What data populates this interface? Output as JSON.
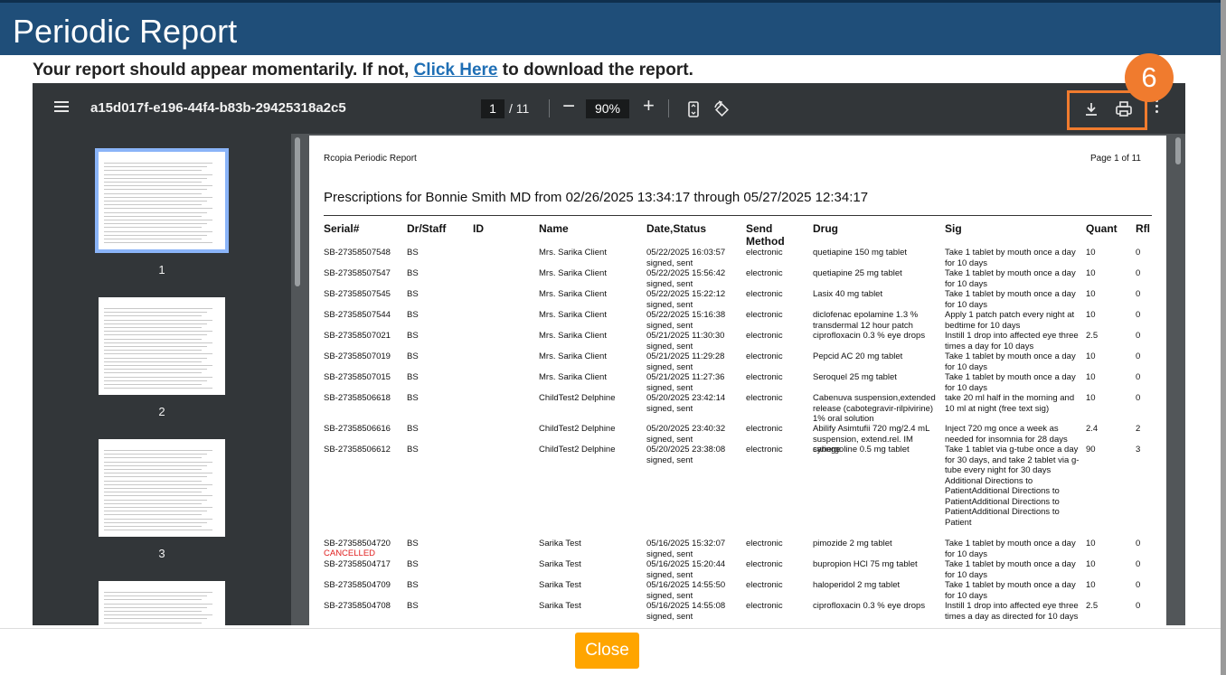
{
  "modal": {
    "title": "Periodic Report"
  },
  "notice": {
    "before": "Your report should appear momentarily. If not, ",
    "link": "Click Here",
    "after": " to download the report."
  },
  "viewer": {
    "file_name": "a15d017f-e196-44f4-b83b-29425318a2c5",
    "page_current": "1",
    "page_total": "/ 11",
    "zoom": "90%",
    "step_badge": "6",
    "thumbnails": [
      "1",
      "2",
      "3"
    ]
  },
  "report": {
    "header_left": "Rcopia Periodic Report",
    "header_right": "Page 1 of 11",
    "title": "Prescriptions for Bonnie Smith MD from 02/26/2025 13:34:17 through 05/27/2025 12:34:17",
    "columns": [
      "Serial#",
      "Dr/Staff",
      "ID",
      "Name",
      "Date,Status",
      "Send Method",
      "Drug",
      "Sig",
      "Quant",
      "Rfl"
    ],
    "rows": [
      [
        "SB-27358507548",
        "BS",
        "",
        "Mrs. Sarika Client",
        "05/22/2025 16:03:57 signed, sent",
        "electronic",
        "quetiapine 150 mg tablet",
        "Take 1 tablet by mouth once a day for 10 days",
        "10",
        "0"
      ],
      [
        "SB-27358507547",
        "BS",
        "",
        "Mrs. Sarika Client",
        "05/22/2025 15:56:42 signed, sent",
        "electronic",
        "quetiapine 25 mg tablet",
        "Take 1 tablet by mouth once a day for 10 days",
        "10",
        "0"
      ],
      [
        "SB-27358507545",
        "BS",
        "",
        "Mrs. Sarika Client",
        "05/22/2025 15:22:12 signed, sent",
        "electronic",
        "Lasix 40 mg tablet",
        "Take 1 tablet by mouth once a day for 10 days",
        "10",
        "0"
      ],
      [
        "SB-27358507544",
        "BS",
        "",
        "Mrs. Sarika Client",
        "05/22/2025 15:16:38 signed, sent",
        "electronic",
        "diclofenac epolamine 1.3 % transdermal 12 hour patch",
        "Apply 1 patch patch every night at bedtime for 10 days",
        "10",
        "0"
      ],
      [
        "SB-27358507021",
        "BS",
        "",
        "Mrs. Sarika Client",
        "05/21/2025 11:30:30 signed, sent",
        "electronic",
        "ciprofloxacin 0.3 % eye drops",
        "Instill 1 drop into affected eye three times a day for 10 days",
        "2.5",
        "0"
      ],
      [
        "SB-27358507019",
        "BS",
        "",
        "Mrs. Sarika Client",
        "05/21/2025 11:29:28 signed, sent",
        "electronic",
        "Pepcid AC 20 mg tablet",
        "Take 1 tablet by mouth once a day for 10 days",
        "10",
        "0"
      ],
      [
        "SB-27358507015",
        "BS",
        "",
        "Mrs. Sarika Client",
        "05/21/2025 11:27:36 signed, sent",
        "electronic",
        "Seroquel 25 mg tablet",
        "Take 1 tablet by mouth once a day for 10 days",
        "10",
        "0"
      ],
      [
        "SB-27358506618",
        "BS",
        "",
        "ChildTest2 Delphine",
        "05/20/2025 23:42:14 signed, sent",
        "electronic",
        "Cabenuva suspension,extended release (cabotegravir-rilpivirine) 1% oral solution",
        "take 20 ml half in the morning and 10 ml at night (free text sig)",
        "10",
        "0"
      ],
      [
        "SB-27358506616",
        "BS",
        "",
        "ChildTest2 Delphine",
        "05/20/2025 23:40:32 signed, sent",
        "electronic",
        "Abilify Asimtufii 720 mg/2.4 mL suspension, extend.rel. IM syringe",
        "Inject 720 mg once a week as needed for insomnia for 28 days",
        "2.4",
        "2"
      ],
      [
        "SB-27358506612",
        "BS",
        "",
        "ChildTest2 Delphine",
        "05/20/2025 23:38:08 signed, sent",
        "electronic",
        "cabergoline 0.5 mg tablet",
        "Take 1 tablet via g-tube once a day for 30 days, and take 2 tablet via g-tube every night for 30 days Additional Directions to PatientAdditional Directions to PatientAdditional Directions to PatientAdditional Directions to Patient",
        "90",
        "3"
      ],
      [
        "SB-27358504720",
        "BS",
        "",
        "Sarika Test",
        "05/16/2025 15:32:07 signed, sent",
        "electronic",
        "pimozide 2 mg tablet",
        "Take 1 tablet by mouth once a day for 10 days",
        "10",
        "0"
      ],
      [
        "SB-27358504717",
        "BS",
        "",
        "Sarika Test",
        "05/16/2025 15:20:44 signed, sent",
        "electronic",
        "bupropion HCl 75 mg tablet",
        "Take 1 tablet by mouth once a day for 10 days",
        "10",
        "0"
      ],
      [
        "SB-27358504709",
        "BS",
        "",
        "Sarika Test",
        "05/16/2025 14:55:50 signed, sent",
        "electronic",
        "haloperidol 2 mg tablet",
        "Take 1 tablet by mouth once a day for 10 days",
        "10",
        "0"
      ],
      [
        "SB-27358504708",
        "BS",
        "",
        "Sarika Test",
        "05/16/2025 14:55:08 signed, sent",
        "electronic",
        "ciprofloxacin 0.3 % eye drops",
        "Instill 1 drop into affected eye three times a day as directed for 10 days",
        "2.5",
        "0"
      ]
    ],
    "cancelled_label": "CANCELLED"
  },
  "footer": {
    "close_label": "Close"
  },
  "colors": {
    "title_bar": "#1f4e79",
    "highlight": "#f07b2e",
    "close_button": "#ffa500",
    "link": "#1f6fb5"
  }
}
